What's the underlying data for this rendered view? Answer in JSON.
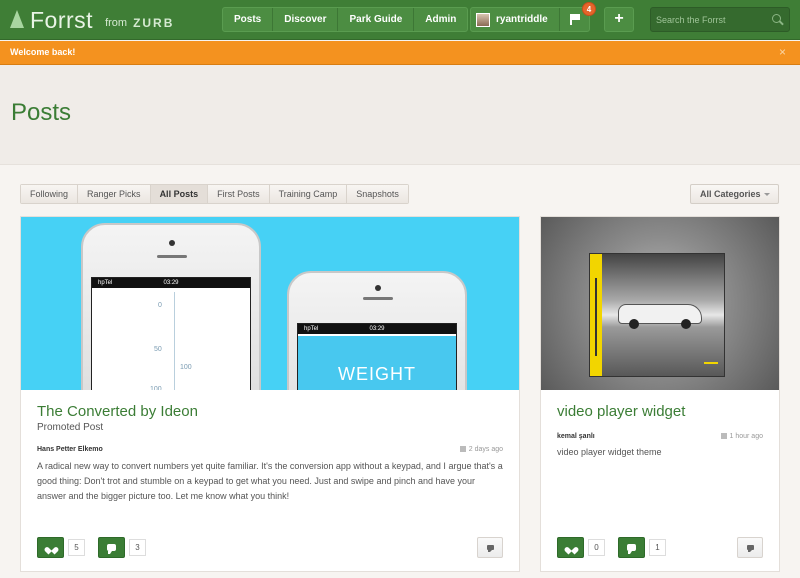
{
  "header": {
    "logo_text": "Forrst",
    "from_text": "from",
    "zurb_text": "ZURB",
    "nav": [
      "Posts",
      "Discover",
      "Park Guide",
      "Admin"
    ],
    "username": "ryantriddle",
    "notification_count": "4",
    "plus_label": "+",
    "search_placeholder": "Search the Forrst"
  },
  "welcome": {
    "message": "Welcome back!",
    "close": "×"
  },
  "page": {
    "title": "Posts"
  },
  "filters": {
    "tabs": [
      "Following",
      "Ranger Picks",
      "All Posts",
      "First Posts",
      "Training Camp",
      "Snapshots"
    ],
    "active": "All Posts",
    "category": "All Categories"
  },
  "posts": [
    {
      "title": "The Converted by Ideon",
      "subtitle": "Promoted Post",
      "author": "Hans Petter Elkemo",
      "time": "2 days ago",
      "body": "A radical new way to convert numbers yet quite familiar. It's the conversion app without a keypad, and I argue that's a good thing: Don't trot and stumble on a keypad to get what you need. Just and swipe and pinch and have your answer and the bigger picture too. Let me know what you think!",
      "likes": "5",
      "comments": "3",
      "phone1": {
        "carrier": "hpTel",
        "clock": "03:29",
        "ticks": [
          "0",
          "50",
          "100"
        ],
        "ruler2": "100"
      },
      "phone2": {
        "carrier": "hpTel",
        "clock": "03:29",
        "app_title": "WEIGHT"
      }
    },
    {
      "title": "video player widget",
      "subtitle": "",
      "author": "kemal şanlı",
      "time": "1 hour ago",
      "body": "video player widget theme",
      "likes": "0",
      "comments": "1"
    }
  ],
  "colors": {
    "brand_green": "#3f7e36",
    "welcome_orange": "#f4921f",
    "link_green": "#3b7d35",
    "badge_orange": "#e5652b"
  }
}
